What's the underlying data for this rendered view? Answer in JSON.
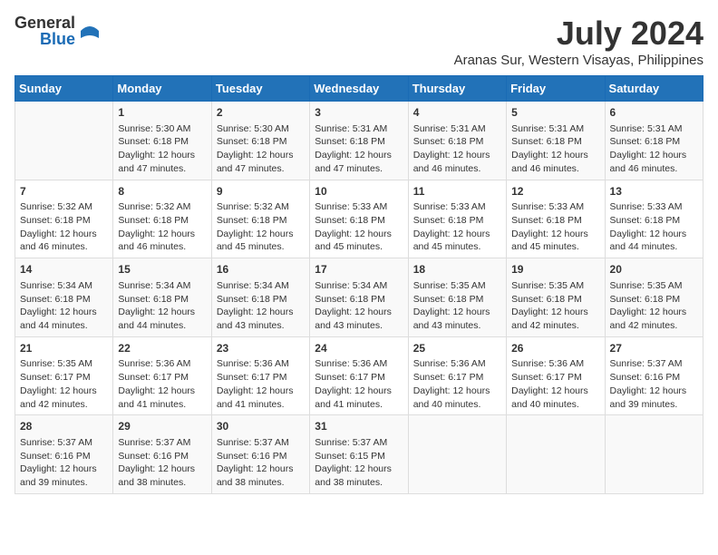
{
  "logo": {
    "general": "General",
    "blue": "Blue"
  },
  "title": "July 2024",
  "subtitle": "Aranas Sur, Western Visayas, Philippines",
  "days": [
    "Sunday",
    "Monday",
    "Tuesday",
    "Wednesday",
    "Thursday",
    "Friday",
    "Saturday"
  ],
  "weeks": [
    [
      {
        "num": "",
        "lines": []
      },
      {
        "num": "1",
        "lines": [
          "Sunrise: 5:30 AM",
          "Sunset: 6:18 PM",
          "Daylight: 12 hours",
          "and 47 minutes."
        ]
      },
      {
        "num": "2",
        "lines": [
          "Sunrise: 5:30 AM",
          "Sunset: 6:18 PM",
          "Daylight: 12 hours",
          "and 47 minutes."
        ]
      },
      {
        "num": "3",
        "lines": [
          "Sunrise: 5:31 AM",
          "Sunset: 6:18 PM",
          "Daylight: 12 hours",
          "and 47 minutes."
        ]
      },
      {
        "num": "4",
        "lines": [
          "Sunrise: 5:31 AM",
          "Sunset: 6:18 PM",
          "Daylight: 12 hours",
          "and 46 minutes."
        ]
      },
      {
        "num": "5",
        "lines": [
          "Sunrise: 5:31 AM",
          "Sunset: 6:18 PM",
          "Daylight: 12 hours",
          "and 46 minutes."
        ]
      },
      {
        "num": "6",
        "lines": [
          "Sunrise: 5:31 AM",
          "Sunset: 6:18 PM",
          "Daylight: 12 hours",
          "and 46 minutes."
        ]
      }
    ],
    [
      {
        "num": "7",
        "lines": [
          "Sunrise: 5:32 AM",
          "Sunset: 6:18 PM",
          "Daylight: 12 hours",
          "and 46 minutes."
        ]
      },
      {
        "num": "8",
        "lines": [
          "Sunrise: 5:32 AM",
          "Sunset: 6:18 PM",
          "Daylight: 12 hours",
          "and 46 minutes."
        ]
      },
      {
        "num": "9",
        "lines": [
          "Sunrise: 5:32 AM",
          "Sunset: 6:18 PM",
          "Daylight: 12 hours",
          "and 45 minutes."
        ]
      },
      {
        "num": "10",
        "lines": [
          "Sunrise: 5:33 AM",
          "Sunset: 6:18 PM",
          "Daylight: 12 hours",
          "and 45 minutes."
        ]
      },
      {
        "num": "11",
        "lines": [
          "Sunrise: 5:33 AM",
          "Sunset: 6:18 PM",
          "Daylight: 12 hours",
          "and 45 minutes."
        ]
      },
      {
        "num": "12",
        "lines": [
          "Sunrise: 5:33 AM",
          "Sunset: 6:18 PM",
          "Daylight: 12 hours",
          "and 45 minutes."
        ]
      },
      {
        "num": "13",
        "lines": [
          "Sunrise: 5:33 AM",
          "Sunset: 6:18 PM",
          "Daylight: 12 hours",
          "and 44 minutes."
        ]
      }
    ],
    [
      {
        "num": "14",
        "lines": [
          "Sunrise: 5:34 AM",
          "Sunset: 6:18 PM",
          "Daylight: 12 hours",
          "and 44 minutes."
        ]
      },
      {
        "num": "15",
        "lines": [
          "Sunrise: 5:34 AM",
          "Sunset: 6:18 PM",
          "Daylight: 12 hours",
          "and 44 minutes."
        ]
      },
      {
        "num": "16",
        "lines": [
          "Sunrise: 5:34 AM",
          "Sunset: 6:18 PM",
          "Daylight: 12 hours",
          "and 43 minutes."
        ]
      },
      {
        "num": "17",
        "lines": [
          "Sunrise: 5:34 AM",
          "Sunset: 6:18 PM",
          "Daylight: 12 hours",
          "and 43 minutes."
        ]
      },
      {
        "num": "18",
        "lines": [
          "Sunrise: 5:35 AM",
          "Sunset: 6:18 PM",
          "Daylight: 12 hours",
          "and 43 minutes."
        ]
      },
      {
        "num": "19",
        "lines": [
          "Sunrise: 5:35 AM",
          "Sunset: 6:18 PM",
          "Daylight: 12 hours",
          "and 42 minutes."
        ]
      },
      {
        "num": "20",
        "lines": [
          "Sunrise: 5:35 AM",
          "Sunset: 6:18 PM",
          "Daylight: 12 hours",
          "and 42 minutes."
        ]
      }
    ],
    [
      {
        "num": "21",
        "lines": [
          "Sunrise: 5:35 AM",
          "Sunset: 6:17 PM",
          "Daylight: 12 hours",
          "and 42 minutes."
        ]
      },
      {
        "num": "22",
        "lines": [
          "Sunrise: 5:36 AM",
          "Sunset: 6:17 PM",
          "Daylight: 12 hours",
          "and 41 minutes."
        ]
      },
      {
        "num": "23",
        "lines": [
          "Sunrise: 5:36 AM",
          "Sunset: 6:17 PM",
          "Daylight: 12 hours",
          "and 41 minutes."
        ]
      },
      {
        "num": "24",
        "lines": [
          "Sunrise: 5:36 AM",
          "Sunset: 6:17 PM",
          "Daylight: 12 hours",
          "and 41 minutes."
        ]
      },
      {
        "num": "25",
        "lines": [
          "Sunrise: 5:36 AM",
          "Sunset: 6:17 PM",
          "Daylight: 12 hours",
          "and 40 minutes."
        ]
      },
      {
        "num": "26",
        "lines": [
          "Sunrise: 5:36 AM",
          "Sunset: 6:17 PM",
          "Daylight: 12 hours",
          "and 40 minutes."
        ]
      },
      {
        "num": "27",
        "lines": [
          "Sunrise: 5:37 AM",
          "Sunset: 6:16 PM",
          "Daylight: 12 hours",
          "and 39 minutes."
        ]
      }
    ],
    [
      {
        "num": "28",
        "lines": [
          "Sunrise: 5:37 AM",
          "Sunset: 6:16 PM",
          "Daylight: 12 hours",
          "and 39 minutes."
        ]
      },
      {
        "num": "29",
        "lines": [
          "Sunrise: 5:37 AM",
          "Sunset: 6:16 PM",
          "Daylight: 12 hours",
          "and 38 minutes."
        ]
      },
      {
        "num": "30",
        "lines": [
          "Sunrise: 5:37 AM",
          "Sunset: 6:16 PM",
          "Daylight: 12 hours",
          "and 38 minutes."
        ]
      },
      {
        "num": "31",
        "lines": [
          "Sunrise: 5:37 AM",
          "Sunset: 6:15 PM",
          "Daylight: 12 hours",
          "and 38 minutes."
        ]
      },
      {
        "num": "",
        "lines": []
      },
      {
        "num": "",
        "lines": []
      },
      {
        "num": "",
        "lines": []
      }
    ]
  ]
}
